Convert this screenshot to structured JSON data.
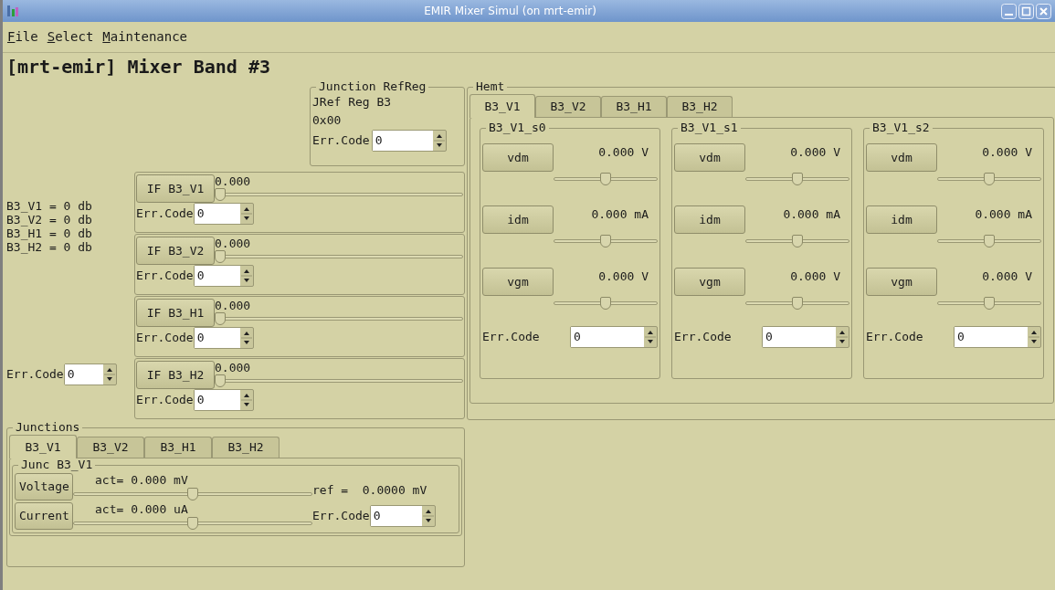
{
  "window": {
    "title": "EMIR Mixer Simul (on mrt-emir)"
  },
  "menu": [
    "File",
    "Select",
    "Maintenance"
  ],
  "heading": "[mrt-emir] Mixer Band #3",
  "junction_refreg": {
    "title": "Junction RefReg",
    "label": "JRef Reg B3",
    "value": "0x00",
    "err_label": "Err.Code",
    "err_value": "0"
  },
  "gains": [
    "B3_V1 = 0 db",
    "B3_V2 = 0 db",
    "B3_H1 = 0 db",
    "B3_H2 = 0 db"
  ],
  "err": {
    "label": "Err.Code",
    "value": "0"
  },
  "if_channels": [
    {
      "button": "IF B3_V1",
      "reading": "0.000",
      "level": 0,
      "err_label": "Err.Code",
      "err_value": "0"
    },
    {
      "button": "IF B3_V2",
      "reading": "0.000",
      "level": 0,
      "err_label": "Err.Code",
      "err_value": "0"
    },
    {
      "button": "IF B3_H1",
      "reading": "0.000",
      "level": 0,
      "err_label": "Err.Code",
      "err_value": "0"
    },
    {
      "button": "IF B3_H2",
      "reading": "0.000",
      "level": 0,
      "err_label": "Err.Code",
      "err_value": "0"
    }
  ],
  "hemt": {
    "title": "Hemt",
    "tabs": [
      {
        "label": "B3_V1",
        "selected": true
      },
      {
        "label": "B3_V2",
        "selected": false
      },
      {
        "label": "B3_H1",
        "selected": false
      },
      {
        "label": "B3_H2",
        "selected": false
      }
    ],
    "stages": [
      {
        "title": "B3_V1_s0",
        "controls": [
          {
            "button": "vdm",
            "reading": "0.000 V",
            "level": 0.5
          },
          {
            "button": "idm",
            "reading": "0.000 mA",
            "level": 0.5
          },
          {
            "button": "vgm",
            "reading": "0.000 V",
            "level": 0.5
          }
        ],
        "err_label": "Err.Code",
        "err_value": "0"
      },
      {
        "title": "B3_V1_s1",
        "controls": [
          {
            "button": "vdm",
            "reading": "0.000 V",
            "level": 0.5
          },
          {
            "button": "idm",
            "reading": "0.000 mA",
            "level": 0.5
          },
          {
            "button": "vgm",
            "reading": "0.000 V",
            "level": 0.5
          }
        ],
        "err_label": "Err.Code",
        "err_value": "0"
      },
      {
        "title": "B3_V1_s2",
        "controls": [
          {
            "button": "vdm",
            "reading": "0.000 V",
            "level": 0.5
          },
          {
            "button": "idm",
            "reading": "0.000 mA",
            "level": 0.5
          },
          {
            "button": "vgm",
            "reading": "0.000 V",
            "level": 0.5
          }
        ],
        "err_label": "Err.Code",
        "err_value": "0"
      }
    ]
  },
  "junctions": {
    "title": "Junctions",
    "tabs": [
      {
        "label": "B3_V1",
        "selected": true
      },
      {
        "label": "B3_V2",
        "selected": false
      },
      {
        "label": "B3_H1",
        "selected": false
      },
      {
        "label": "B3_H2",
        "selected": false
      }
    ],
    "group_title": "Junc B3_V1",
    "rows": [
      {
        "button": "Voltage",
        "reading": "act= 0.000 mV",
        "level": 0.5
      },
      {
        "button": "Current",
        "reading": "act= 0.000 uA",
        "level": 0.5
      }
    ],
    "ref": "ref =  0.0000 mV",
    "err_label": "Err.Code",
    "err_value": "0"
  }
}
